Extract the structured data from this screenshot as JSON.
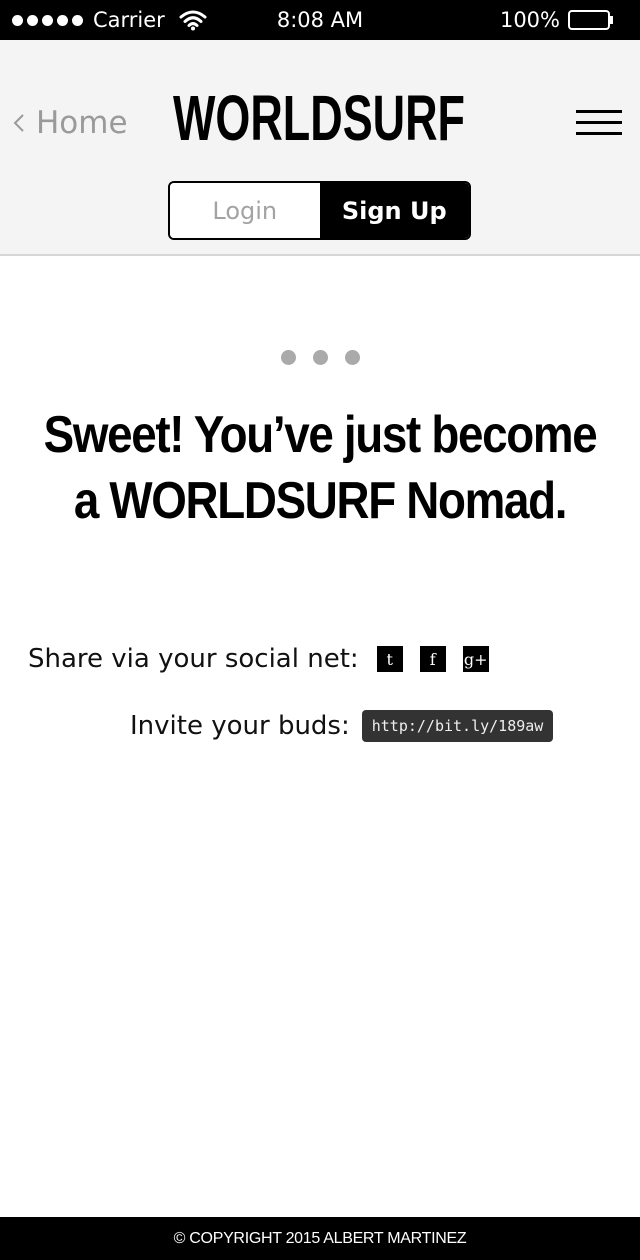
{
  "status_bar": {
    "carrier": "Carrier",
    "time": "8:08 AM",
    "battery": "100%"
  },
  "header": {
    "back_label": "Home",
    "logo_text": "WORLDSURF",
    "tabs": [
      {
        "label": "Login",
        "active": false
      },
      {
        "label": "Sign Up",
        "active": true
      }
    ]
  },
  "main": {
    "headline_line1": "Sweet! You’ve just become",
    "headline_line2": "a WORLDSURF Nomad.",
    "share_label": "Share via your social net:",
    "social": [
      {
        "icon": "twitter-icon",
        "glyph": "t"
      },
      {
        "icon": "facebook-icon",
        "glyph": "f"
      },
      {
        "icon": "google-plus-icon",
        "glyph": "g+"
      }
    ],
    "invite_label": "Invite your buds:",
    "invite_link": "http://bit.ly/189aw"
  },
  "footer": {
    "copyright": "© COPYRIGHT 2015 ALBERT MARTINEZ"
  },
  "colors": {
    "header_bg": "#f4f4f4",
    "accent": "#000000",
    "muted_text": "#9a9a9a",
    "link_bg": "#333333"
  }
}
